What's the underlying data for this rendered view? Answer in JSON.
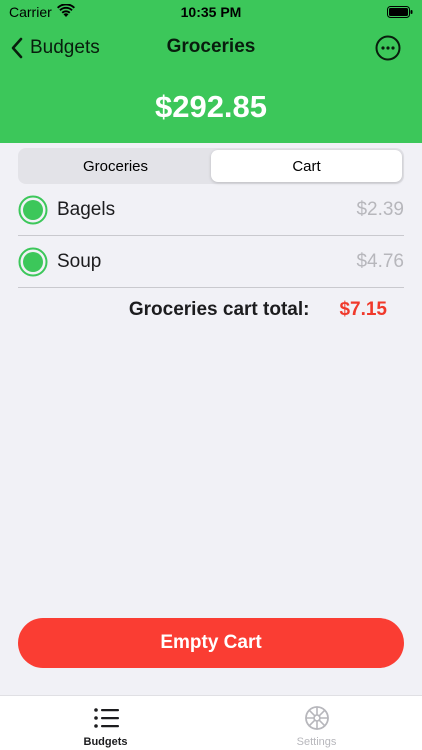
{
  "status_bar": {
    "carrier": "Carrier",
    "time": "10:35 PM"
  },
  "nav": {
    "back_label": "Budgets",
    "title": "Groceries",
    "more_icon": "ellipsis-circle-icon"
  },
  "balance": "$292.85",
  "segments": [
    {
      "label": "Groceries",
      "active": false
    },
    {
      "label": "Cart",
      "active": true
    }
  ],
  "cart_items": [
    {
      "name": "Bagels",
      "price": "$2.39",
      "checked": true
    },
    {
      "name": "Soup",
      "price": "$4.76",
      "checked": true
    }
  ],
  "total": {
    "label": "Groceries cart total:",
    "value": "$7.15"
  },
  "empty_cart_label": "Empty Cart",
  "tabs": [
    {
      "label": "Budgets",
      "icon": "list-icon",
      "active": true
    },
    {
      "label": "Settings",
      "icon": "gear-icon",
      "active": false
    }
  ],
  "colors": {
    "header_green": "#3cc75a",
    "check_green": "#3cc75a",
    "danger_red": "#fa3d33",
    "total_red": "#f0392b"
  }
}
